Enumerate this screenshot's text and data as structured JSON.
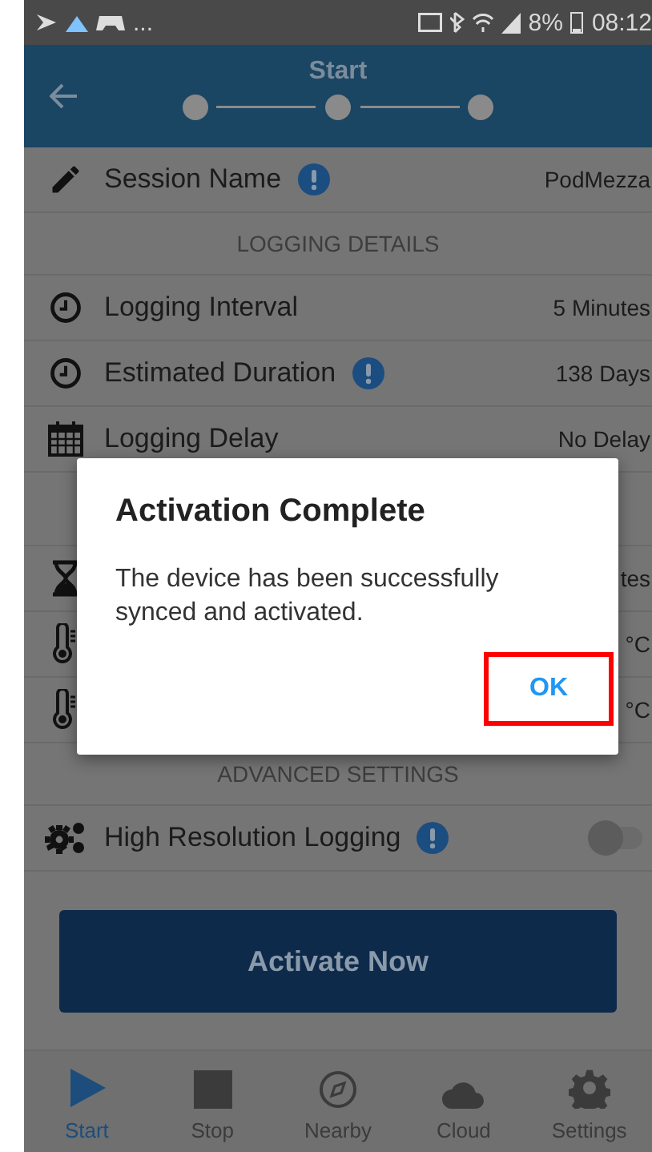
{
  "status_bar": {
    "notifications": "...",
    "battery": "8%",
    "time": "08:12"
  },
  "header": {
    "title": "Start"
  },
  "rows": [
    {
      "kind": "setting",
      "label": "Session Name",
      "info": true,
      "value": "PodMezza"
    },
    {
      "kind": "section",
      "label": "LOGGING DETAILS"
    },
    {
      "kind": "setting",
      "label": "Logging Interval",
      "info": false,
      "value": "5 Minutes"
    },
    {
      "kind": "setting",
      "label": "Estimated Duration",
      "info": true,
      "value": "138 Days"
    },
    {
      "kind": "setting",
      "label": "Logging Delay",
      "info": false,
      "value": "No Delay"
    },
    {
      "kind": "gap"
    },
    {
      "kind": "setting",
      "info": false,
      "value": "tes"
    },
    {
      "kind": "setting",
      "info": false,
      "value": "°C"
    },
    {
      "kind": "setting",
      "info": false,
      "value": "°C"
    },
    {
      "kind": "section",
      "label": "ADVANCED SETTINGS"
    },
    {
      "kind": "toggle",
      "label": "High Resolution Logging",
      "info": true,
      "on": false
    }
  ],
  "action_button": "Activate Now",
  "nav": [
    {
      "label": "Start",
      "selected": true
    },
    {
      "label": "Stop",
      "selected": false
    },
    {
      "label": "Nearby",
      "selected": false
    },
    {
      "label": "Cloud",
      "selected": false
    },
    {
      "label": "Settings",
      "selected": false
    }
  ],
  "dialog": {
    "title": "Activation Complete",
    "message": "The device has been successfully synced and activated.",
    "button": "OK",
    "highlighted": true
  }
}
